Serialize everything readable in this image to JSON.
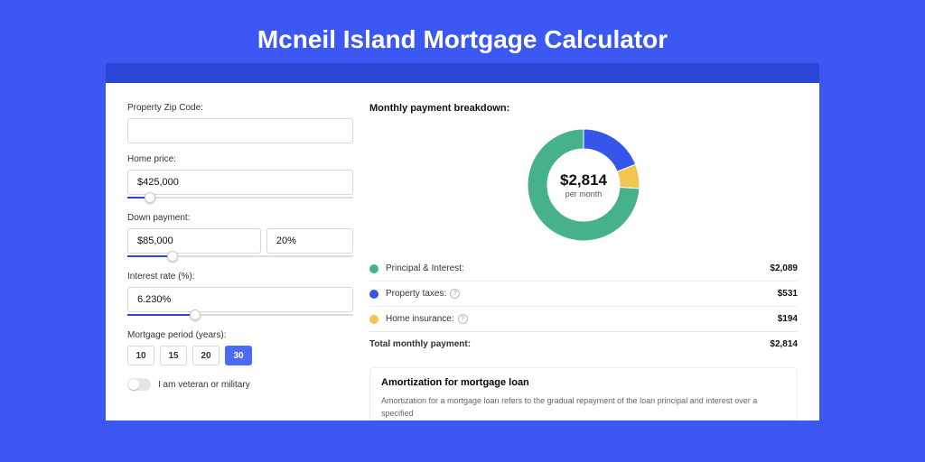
{
  "page_title": "Mcneil Island Mortgage Calculator",
  "form": {
    "zip_label": "Property Zip Code:",
    "zip_value": "",
    "home_price_label": "Home price:",
    "home_price_value": "$425,000",
    "home_price_slider_pct": 10,
    "down_payment_label": "Down payment:",
    "down_payment_value": "$85,000",
    "down_payment_pct_value": "20%",
    "down_payment_slider_pct": 20,
    "interest_label": "Interest rate (%):",
    "interest_value": "6.230%",
    "interest_slider_pct": 30,
    "period_label": "Mortgage period (years):",
    "periods": [
      "10",
      "15",
      "20",
      "30"
    ],
    "period_selected": 3,
    "veteran_label": "I am veteran or military"
  },
  "breakdown": {
    "heading": "Monthly payment breakdown:",
    "center_amount": "$2,814",
    "center_sub": "per month",
    "items": [
      {
        "label": "Principal & Interest:",
        "value": "$2,089",
        "color": "#47b28a",
        "info": false,
        "pct": 74
      },
      {
        "label": "Property taxes:",
        "value": "$531",
        "color": "#3556e8",
        "info": true,
        "pct": 19
      },
      {
        "label": "Home insurance:",
        "value": "$194",
        "color": "#f3c64f",
        "info": true,
        "pct": 7
      }
    ],
    "total_label": "Total monthly payment:",
    "total_value": "$2,814"
  },
  "amort": {
    "title": "Amortization for mortgage loan",
    "text": "Amortization for a mortgage loan refers to the gradual repayment of the loan principal and interest over a specified"
  },
  "chart_data": {
    "type": "pie",
    "title": "Monthly payment breakdown",
    "series": [
      {
        "name": "Principal & Interest",
        "value": 2089,
        "color": "#47b28a"
      },
      {
        "name": "Property taxes",
        "value": 531,
        "color": "#3556e8"
      },
      {
        "name": "Home insurance",
        "value": 194,
        "color": "#f3c64f"
      }
    ],
    "total": 2814,
    "center_label": "$2,814 per month",
    "donut": true
  }
}
